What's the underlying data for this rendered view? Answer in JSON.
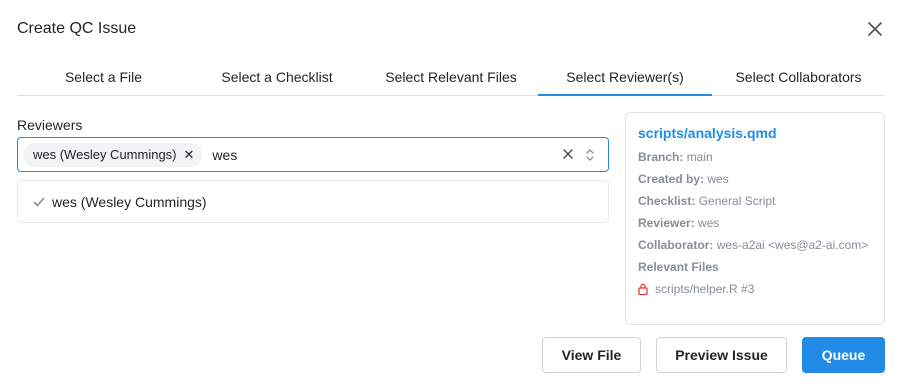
{
  "dialog": {
    "title": "Create QC Issue",
    "close_icon": "close-icon"
  },
  "tabs": [
    {
      "label": "Select a File",
      "active": false
    },
    {
      "label": "Select a Checklist",
      "active": false
    },
    {
      "label": "Select Relevant Files",
      "active": false
    },
    {
      "label": "Select Reviewer(s)",
      "active": true
    },
    {
      "label": "Select Collaborators",
      "active": false
    }
  ],
  "reviewers": {
    "label": "Reviewers",
    "selected_pill": "wes (Wesley Cummings)",
    "search_value": "wes",
    "options": [
      {
        "label": "wes (Wesley Cummings)",
        "selected": true
      }
    ]
  },
  "summary": {
    "file": "scripts/analysis.qmd",
    "branch_label": "Branch:",
    "branch": "main",
    "created_by_label": "Created by:",
    "created_by": "wes",
    "checklist_label": "Checklist:",
    "checklist": "General Script",
    "reviewer_label": "Reviewer:",
    "reviewer": "wes",
    "collaborator_label": "Collaborator:",
    "collaborator": "wes-a2ai <wes@a2-ai.com>",
    "relevant_files_label": "Relevant Files",
    "relevant_files": [
      {
        "name": "scripts/helper.R #3",
        "icon": "lock-icon"
      }
    ]
  },
  "actions": {
    "view_file": "View File",
    "preview_issue": "Preview Issue",
    "queue": "Queue"
  },
  "colors": {
    "accent": "#228be6",
    "muted_text": "#868e96",
    "lock": "#e03131"
  }
}
